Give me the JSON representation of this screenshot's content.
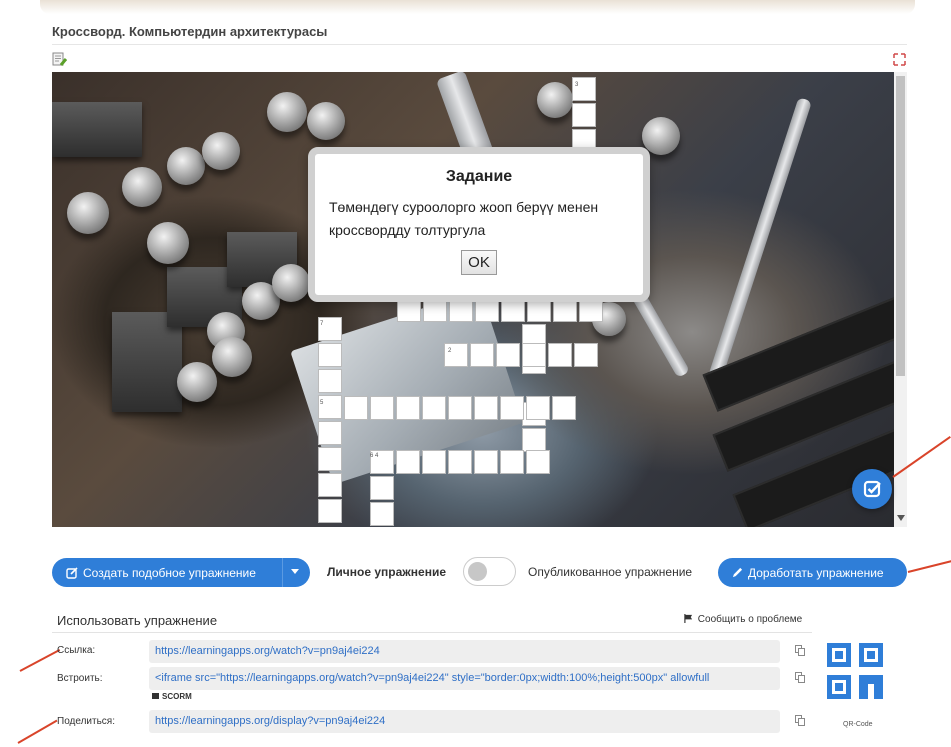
{
  "exercise": {
    "title": "Кроссворд. Компьютердин архитектурасы"
  },
  "dialog": {
    "title": "Задание",
    "text": "Төмөндөгү суроолорго жооп берүү менен кроссвордду толтургула",
    "ok_label": "OK"
  },
  "crossword": {
    "numbers": [
      "3",
      "7",
      "2",
      "5",
      "6",
      "4"
    ]
  },
  "actions": {
    "create_label": "Создать подобное упражнение",
    "private_label": "Личное упражнение",
    "published_label": "Опубликованное упражнение",
    "improve_label": "Доработать упражнение"
  },
  "use": {
    "title": "Использовать упражнение",
    "report_label": "Сообщить о проблеме",
    "link_label": "Ссылка:",
    "link_value": "https://learningapps.org/watch?v=pn9aj4ei224",
    "embed_label": "Встроить:",
    "embed_value": "<iframe src=\"https://learningapps.org/watch?v=pn9aj4ei224\" style=\"border:0px;width:100%;height:500px\" allowfull",
    "scorm_label": "SCORM",
    "share_label": "Поделиться:",
    "share_value": "https://learningapps.org/display?v=pn9aj4ei224",
    "qr_label": "QR-Code"
  },
  "colors": {
    "accent": "#2f7ed8",
    "annotation": "#d9442a"
  },
  "icons": [
    "help-icon",
    "fullscreen-icon",
    "check-edit-icon",
    "pencil-icon",
    "edit-icon",
    "chevron-down-icon",
    "flag-icon",
    "copy-icon",
    "scorm-icon",
    "qr-code-icon"
  ]
}
